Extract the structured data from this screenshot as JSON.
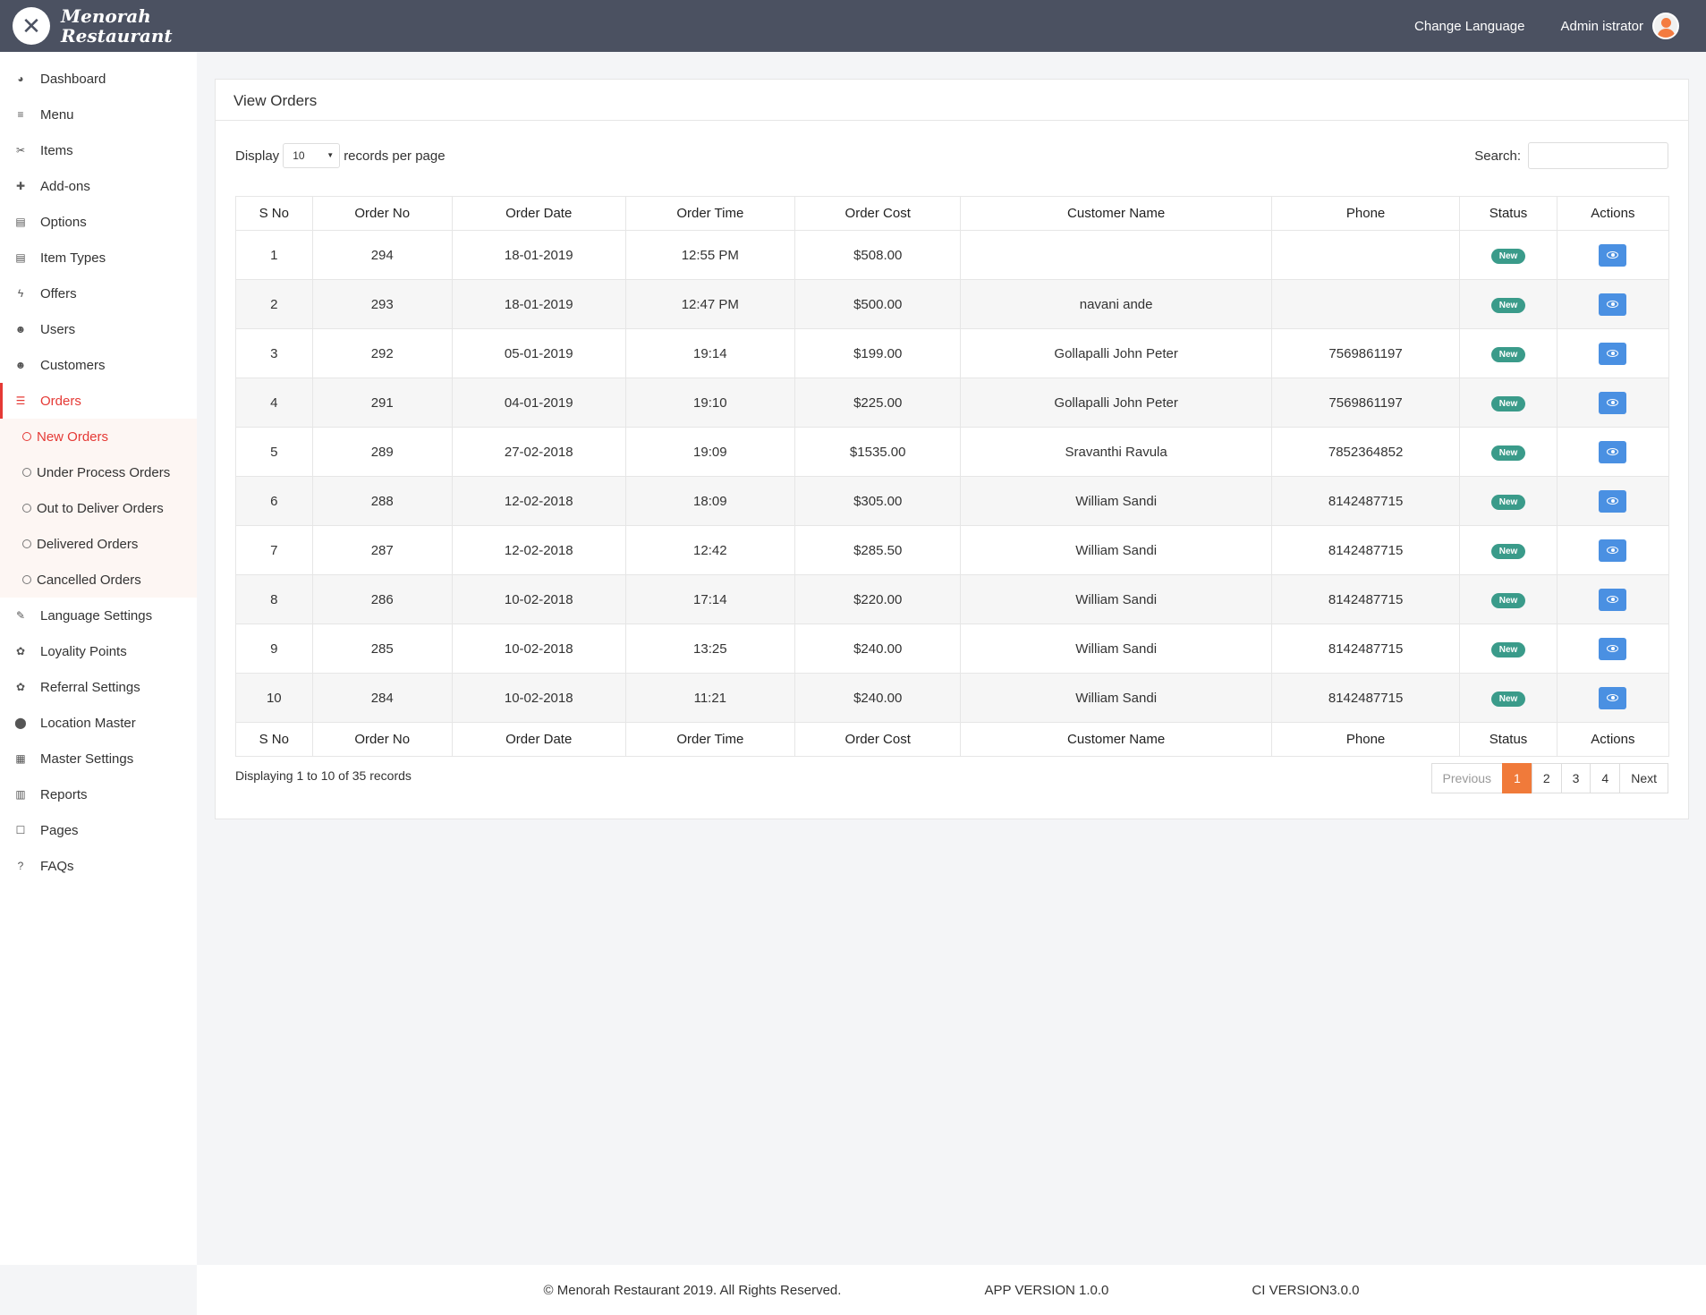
{
  "brand": {
    "name": "Menorah Restaurant",
    "line1": "Menorah",
    "line2": "Restaurant"
  },
  "header": {
    "change_language": "Change Language",
    "user_name": "Admin istrator"
  },
  "sidebar": {
    "items": [
      {
        "label": "Dashboard",
        "icon": "dashboard-icon",
        "glyph": "◕"
      },
      {
        "label": "Menu",
        "icon": "menu-icon",
        "glyph": "≡"
      },
      {
        "label": "Items",
        "icon": "cutlery-icon",
        "glyph": "✂"
      },
      {
        "label": "Add-ons",
        "icon": "plus-icon",
        "glyph": "✚"
      },
      {
        "label": "Options",
        "icon": "list-icon",
        "glyph": "▤"
      },
      {
        "label": "Item Types",
        "icon": "list-icon",
        "glyph": "▤"
      },
      {
        "label": "Offers",
        "icon": "bolt-icon",
        "glyph": "ϟ"
      },
      {
        "label": "Users",
        "icon": "users-icon",
        "glyph": "☻"
      },
      {
        "label": "Customers",
        "icon": "user-icon",
        "glyph": "☻"
      },
      {
        "label": "Orders",
        "icon": "list-icon",
        "glyph": "☰"
      }
    ],
    "orders_sub": [
      {
        "label": "New Orders"
      },
      {
        "label": "Under Process Orders"
      },
      {
        "label": "Out to Deliver Orders"
      },
      {
        "label": "Delivered Orders"
      },
      {
        "label": "Cancelled Orders"
      }
    ],
    "items_after": [
      {
        "label": "Language Settings",
        "icon": "language-icon",
        "glyph": "✎"
      },
      {
        "label": "Loyality Points",
        "icon": "gift-icon",
        "glyph": "✿"
      },
      {
        "label": "Referral Settings",
        "icon": "gift-icon",
        "glyph": "✿"
      },
      {
        "label": "Location Master",
        "icon": "map-marker-icon",
        "glyph": "⬤"
      },
      {
        "label": "Master Settings",
        "icon": "qrcode-icon",
        "glyph": "▦"
      },
      {
        "label": "Reports",
        "icon": "bar-chart-icon",
        "glyph": "▥"
      },
      {
        "label": "Pages",
        "icon": "square-icon",
        "glyph": "☐"
      },
      {
        "label": "FAQs",
        "icon": "question-icon",
        "glyph": "?"
      }
    ]
  },
  "panel": {
    "title": "View Orders",
    "display_label": "Display",
    "per_page_value": "10",
    "records_label": "records per page",
    "search_label": "Search:",
    "columns": [
      "S No",
      "Order No",
      "Order Date",
      "Order Time",
      "Order Cost",
      "Customer Name",
      "Phone",
      "Status",
      "Actions"
    ],
    "rows": [
      {
        "sno": "1",
        "order_no": "294",
        "date": "18-01-2019",
        "time": "12:55 PM",
        "cost": "$508.00",
        "customer": "",
        "phone": "",
        "status": "New"
      },
      {
        "sno": "2",
        "order_no": "293",
        "date": "18-01-2019",
        "time": "12:47 PM",
        "cost": "$500.00",
        "customer": "navani ande",
        "phone": "",
        "status": "New"
      },
      {
        "sno": "3",
        "order_no": "292",
        "date": "05-01-2019",
        "time": "19:14",
        "cost": "$199.00",
        "customer": "Gollapalli John Peter",
        "phone": "7569861197",
        "status": "New"
      },
      {
        "sno": "4",
        "order_no": "291",
        "date": "04-01-2019",
        "time": "19:10",
        "cost": "$225.00",
        "customer": "Gollapalli John Peter",
        "phone": "7569861197",
        "status": "New"
      },
      {
        "sno": "5",
        "order_no": "289",
        "date": "27-02-2018",
        "time": "19:09",
        "cost": "$1535.00",
        "customer": "Sravanthi Ravula",
        "phone": "7852364852",
        "status": "New"
      },
      {
        "sno": "6",
        "order_no": "288",
        "date": "12-02-2018",
        "time": "18:09",
        "cost": "$305.00",
        "customer": "William Sandi",
        "phone": "8142487715",
        "status": "New"
      },
      {
        "sno": "7",
        "order_no": "287",
        "date": "12-02-2018",
        "time": "12:42",
        "cost": "$285.50",
        "customer": "William Sandi",
        "phone": "8142487715",
        "status": "New"
      },
      {
        "sno": "8",
        "order_no": "286",
        "date": "10-02-2018",
        "time": "17:14",
        "cost": "$220.00",
        "customer": "William Sandi",
        "phone": "8142487715",
        "status": "New"
      },
      {
        "sno": "9",
        "order_no": "285",
        "date": "10-02-2018",
        "time": "13:25",
        "cost": "$240.00",
        "customer": "William Sandi",
        "phone": "8142487715",
        "status": "New"
      },
      {
        "sno": "10",
        "order_no": "284",
        "date": "10-02-2018",
        "time": "11:21",
        "cost": "$240.00",
        "customer": "William Sandi",
        "phone": "8142487715",
        "status": "New"
      }
    ],
    "info": "Displaying 1 to 10 of 35 records",
    "pagination": {
      "previous": "Previous",
      "pages": [
        "1",
        "2",
        "3",
        "4"
      ],
      "current": "1",
      "next": "Next"
    }
  },
  "footer": {
    "copyright": "© Menorah Restaurant 2019. All Rights Reserved.",
    "app_version": "APP VERSION 1.0.0",
    "ci_version": "CI VERSION3.0.0"
  },
  "colors": {
    "topbar": "#4b5161",
    "accent": "#e53935",
    "badge": "#3a9b8a",
    "view_button": "#4a90e2",
    "page_active": "#f07a3a"
  }
}
